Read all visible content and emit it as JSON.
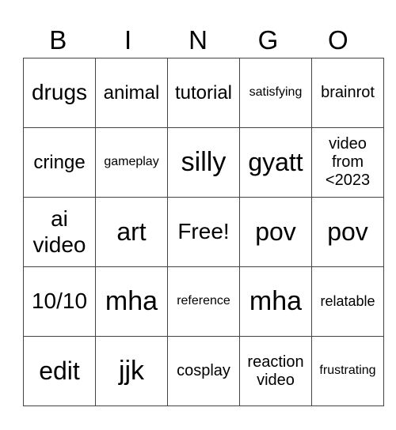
{
  "header": [
    "B",
    "I",
    "N",
    "G",
    "O"
  ],
  "rows": [
    [
      "drugs",
      "animal",
      "tutorial",
      "satisfying",
      "brainrot"
    ],
    [
      "cringe",
      "gameplay",
      "silly",
      "gyatt",
      "video from <2023"
    ],
    [
      "ai video",
      "art",
      "Free!",
      "pov",
      "pov"
    ],
    [
      "10/10",
      "mha",
      "reference",
      "mha",
      "relatable"
    ],
    [
      "edit",
      "jjk",
      "cosplay",
      "reaction video",
      "frustrating"
    ]
  ]
}
